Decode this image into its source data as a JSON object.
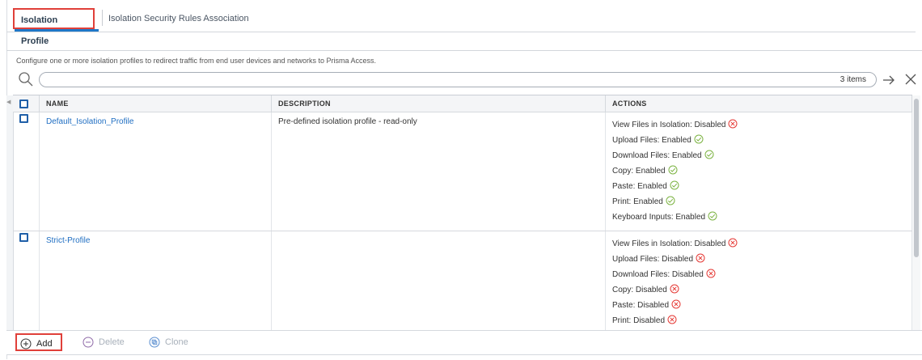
{
  "tabs": [
    {
      "label": "Isolation Profile",
      "active": true
    },
    {
      "label": "Isolation Security Rules Association",
      "active": false
    }
  ],
  "description": "Configure one or more isolation profiles to redirect traffic from end user devices and networks to Prisma Access.",
  "search": {
    "value": "",
    "placeholder": "",
    "item_count": "3 items"
  },
  "table": {
    "headers": {
      "name": "NAME",
      "description": "DESCRIPTION",
      "actions": "ACTIONS"
    },
    "rows": [
      {
        "name": "Default_Isolation_Profile",
        "description": "Pre-defined isolation profile - read-only",
        "actions": [
          {
            "label": "View Files in Isolation: Disabled",
            "status": "disabled"
          },
          {
            "label": "Upload Files: Enabled",
            "status": "enabled"
          },
          {
            "label": "Download Files: Enabled",
            "status": "enabled"
          },
          {
            "label": "Copy: Enabled",
            "status": "enabled"
          },
          {
            "label": "Paste: Enabled",
            "status": "enabled"
          },
          {
            "label": "Print: Enabled",
            "status": "enabled"
          },
          {
            "label": "Keyboard Inputs: Enabled",
            "status": "enabled"
          }
        ]
      },
      {
        "name": "Strict-Profile",
        "description": "",
        "actions": [
          {
            "label": "View Files in Isolation: Disabled",
            "status": "disabled"
          },
          {
            "label": "Upload Files: Disabled",
            "status": "disabled"
          },
          {
            "label": "Download Files: Disabled",
            "status": "disabled"
          },
          {
            "label": "Copy: Disabled",
            "status": "disabled"
          },
          {
            "label": "Paste: Disabled",
            "status": "disabled"
          },
          {
            "label": "Print: Disabled",
            "status": "disabled"
          }
        ]
      }
    ]
  },
  "footer": {
    "add_label": "Add",
    "delete_label": "Delete",
    "clone_label": "Clone"
  },
  "colors": {
    "accent": "#1f77c8",
    "link": "#1f6ec2",
    "enabled": "#7cb342",
    "disabled": "#e53935",
    "highlight": "#e0403a"
  }
}
